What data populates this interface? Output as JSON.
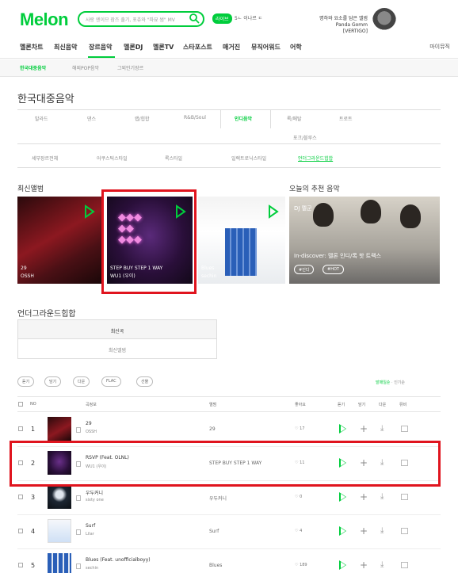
{
  "header": {
    "logo": "Melon",
    "search_placeholder": "사랑 엔이므 잠즈 출기, 포츄와 \"파묘 썸\" MV",
    "live_badge": "라이브",
    "user": "5ㄴ 이나르 ㄷ",
    "promo_line1": "명하와 요소를 담은 앨범",
    "promo_line2": "Panda Gomm [VERTIGO]"
  },
  "gnb": {
    "items": [
      "멜론차트",
      "최신음악",
      "장르음악",
      "멜론DJ",
      "멜론TV",
      "스타포스트",
      "매거진",
      "뮤직어워드",
      "어학"
    ],
    "mymusic": "마이뮤직"
  },
  "subnav": {
    "items": [
      "한국대중음악",
      "해외POP음악",
      "그외인기장르"
    ]
  },
  "section_title": "한국대중음악",
  "genres": {
    "row1": [
      "발라드",
      "댄스",
      "랩/힙합",
      "R&B/Soul",
      "인디음악",
      "록/메탈",
      "트로트"
    ],
    "row2": [
      "포크/블루스"
    ],
    "sub": [
      "세부장르전체",
      "어쿠스틱스타일",
      "록스타일",
      "일렉트로닉스타일",
      "언더그라운드힙합"
    ]
  },
  "latest_albums": {
    "title": "최신앨범",
    "albums": [
      {
        "title": "29",
        "artist": "OSSH"
      },
      {
        "title": "STEP BUY STEP 1 WAY",
        "artist": "WU1 (우이)"
      },
      {
        "title": "Blues",
        "artist": "sechin"
      }
    ]
  },
  "recommend": {
    "title": "오늘의 추천 음악",
    "badge": "DJ 멜군",
    "headline": "In-discover: 멜론 인디/록 핫 트랙스",
    "tags": [
      "#인디",
      "#HOT"
    ]
  },
  "underground": {
    "title": "언더그라운드힙합",
    "tabs": [
      "최신곡",
      "최신앨범"
    ]
  },
  "toolbar": {
    "buttons": [
      "듣기",
      "담기",
      "다운",
      "FLAC",
      "선물"
    ],
    "sort_on": "발매일순",
    "sort_off": "인기순"
  },
  "table": {
    "headers": [
      "NO",
      "곡정보",
      "앨범",
      "좋아요",
      "듣기",
      "담기",
      "다운",
      "뮤비"
    ],
    "rows": [
      {
        "rank": "1",
        "song": "29",
        "artist": "OSSH",
        "album": "29",
        "likes": "♡ 17"
      },
      {
        "rank": "2",
        "song": "RSVP (Feat. OLNL)",
        "artist": "WU1 (우이)",
        "album": "STEP BUY STEP 1 WAY",
        "likes": "♡ 11"
      },
      {
        "rank": "3",
        "song": "우두커니",
        "artist": "sixty one",
        "album": "우두커니",
        "likes": "♡ 0"
      },
      {
        "rank": "4",
        "song": "Surf",
        "artist": "Lilar",
        "album": "Surf",
        "likes": "♡ 4"
      },
      {
        "rank": "5",
        "song": "Blues (Feat. unofficialboyy)",
        "artist": "sechin",
        "album": "Blues",
        "likes": "♡ 189"
      }
    ]
  }
}
